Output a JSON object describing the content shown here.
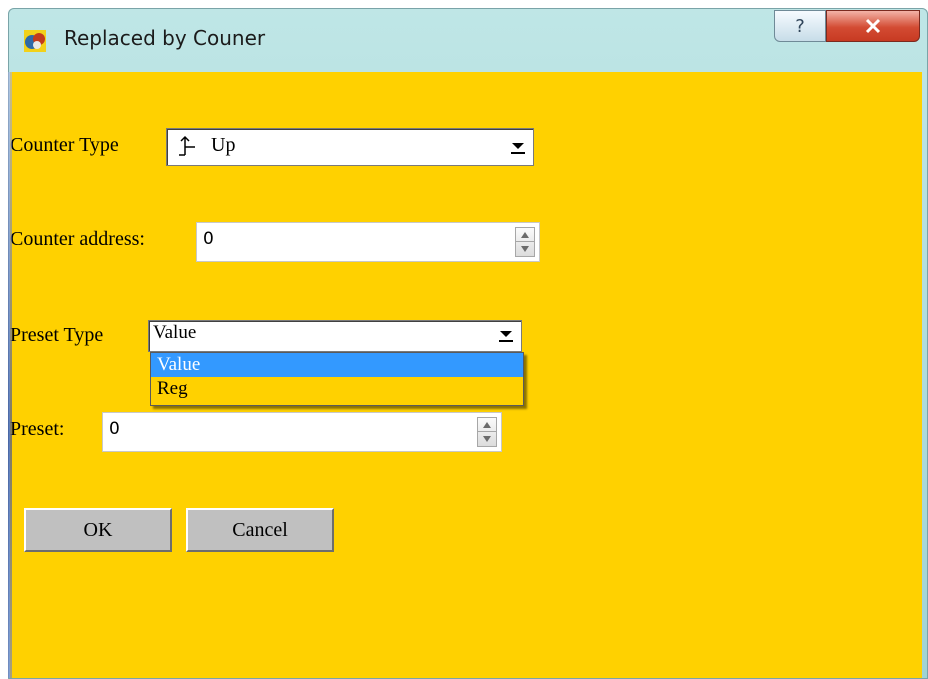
{
  "window": {
    "title": "Replaced by Couner",
    "help_label": "?",
    "close_label": "X"
  },
  "form": {
    "counter_type": {
      "label": "Counter Type",
      "selected_value": "Up",
      "icon": "counter-up-icon"
    },
    "counter_address": {
      "label": "Counter address:",
      "value": "0"
    },
    "preset_type": {
      "label": "Preset Type",
      "selected_value": "Value",
      "options": [
        "Value",
        "Reg"
      ],
      "highlighted_option": "Value"
    },
    "preset": {
      "label": "Preset:",
      "value": "0"
    }
  },
  "buttons": {
    "ok_label": "OK",
    "cancel_label": "Cancel"
  },
  "colors": {
    "client_background": "#ffd100",
    "selection_blue": "#3399ff",
    "button_gray": "#c0c0c0"
  }
}
